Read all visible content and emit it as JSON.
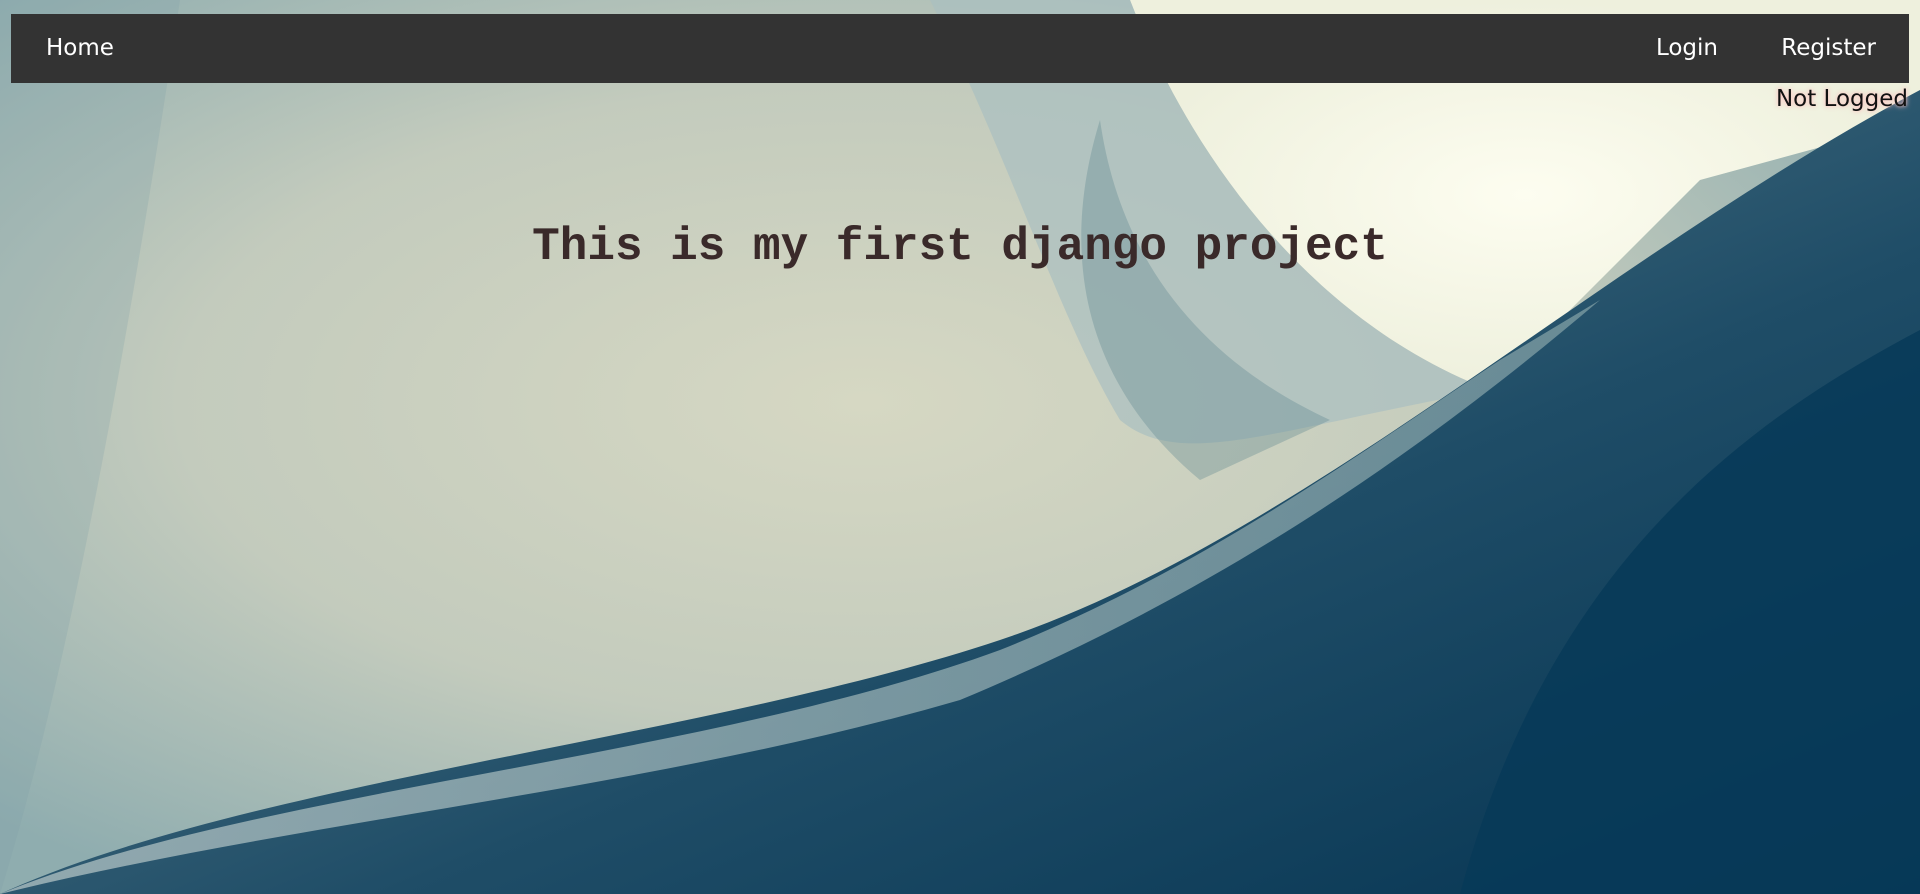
{
  "navbar": {
    "home_label": "Home",
    "login_label": "Login",
    "register_label": "Register"
  },
  "auth_status": "Not Logged",
  "main": {
    "headline": "This is my first django project"
  },
  "colors": {
    "navbar_bg": "#333333",
    "nav_text": "#ffffff",
    "headline_text": "#3a2a2a",
    "bg_light": "#d3d6c2",
    "bg_dark": "#0b3a57"
  },
  "background": {
    "icon": "abstract-architecture-image"
  }
}
